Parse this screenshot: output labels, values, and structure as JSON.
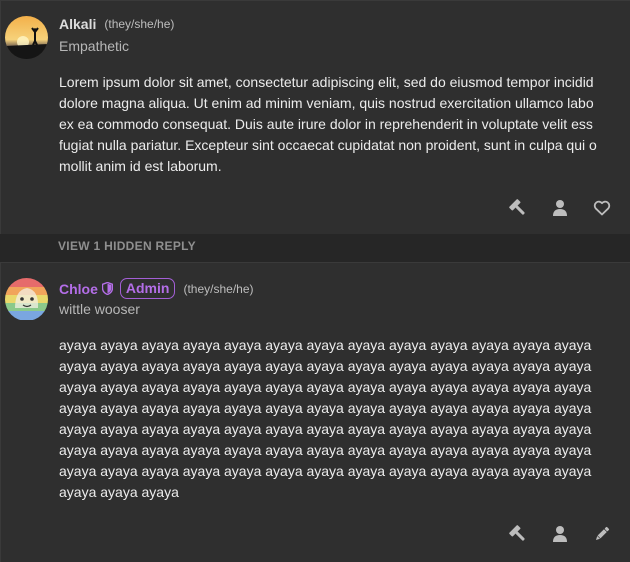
{
  "posts": [
    {
      "username": "Alkali",
      "pronouns": "(they/she/he)",
      "status": "Empathetic",
      "body_lines": [
        "Lorem ipsum dolor sit amet, consectetur adipiscing elit, sed do eiusmod tempor incidid",
        "dolore magna aliqua. Ut enim ad minim veniam, quis nostrud exercitation ullamco labo",
        "ex ea commodo consequat. Duis aute irure dolor in reprehenderit in voluptate velit ess",
        "fugiat nulla pariatur. Excepteur sint occaecat cupidatat non proident, sunt in culpa qui o",
        "mollit anim id est laborum."
      ],
      "actions": [
        "hammer-icon",
        "user-icon",
        "heart-icon"
      ]
    },
    {
      "username": "Chloe",
      "badge": "Admin",
      "pronouns": "(they/she/he)",
      "status": "wittle wooser",
      "body_lines": [
        "ayaya ayaya ayaya ayaya ayaya ayaya ayaya ayaya ayaya ayaya ayaya ayaya ayaya",
        "ayaya ayaya ayaya ayaya ayaya ayaya ayaya ayaya ayaya ayaya ayaya ayaya ayaya",
        "ayaya ayaya ayaya ayaya ayaya ayaya ayaya ayaya ayaya ayaya ayaya ayaya ayaya",
        "ayaya ayaya ayaya ayaya ayaya ayaya ayaya ayaya ayaya ayaya ayaya ayaya ayaya",
        "ayaya ayaya ayaya ayaya ayaya ayaya ayaya ayaya ayaya ayaya ayaya ayaya ayaya",
        "ayaya ayaya ayaya ayaya ayaya ayaya ayaya ayaya ayaya ayaya ayaya ayaya ayaya",
        "ayaya ayaya ayaya ayaya ayaya ayaya ayaya ayaya ayaya ayaya ayaya ayaya ayaya",
        "ayaya ayaya ayaya"
      ],
      "actions": [
        "hammer-icon",
        "user-icon",
        "pencil-icon"
      ]
    }
  ],
  "hidden_reply": {
    "label": "VIEW 1 HIDDEN REPLY"
  },
  "colors": {
    "admin": "#b46ee8",
    "icon": "#bdbdbd",
    "background": "#2f2f2f"
  }
}
